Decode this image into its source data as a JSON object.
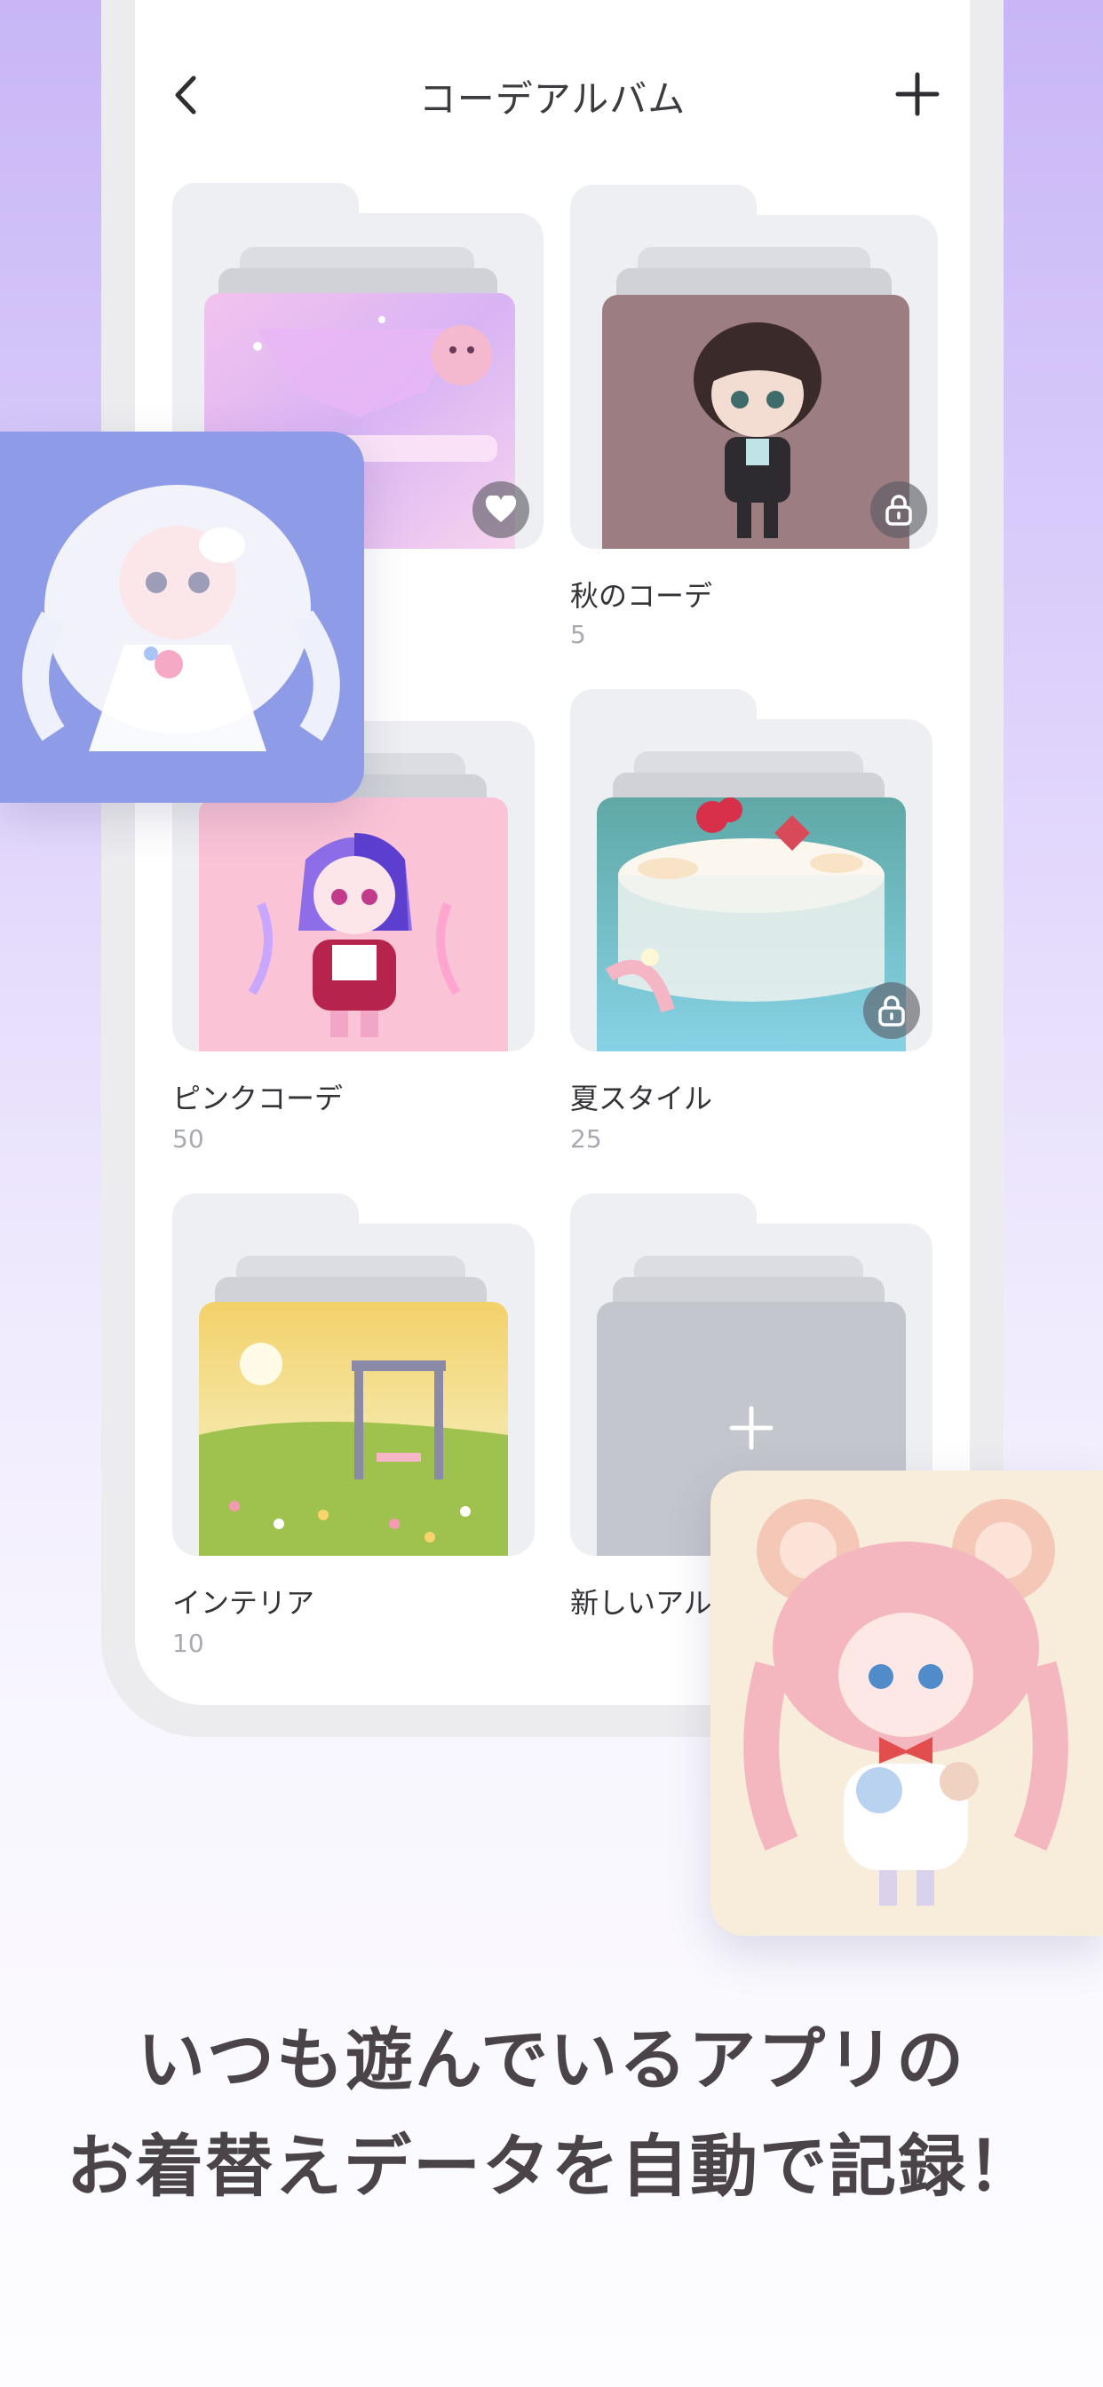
{
  "header": {
    "title": "コーデアルバム"
  },
  "albums": [
    {
      "name": "",
      "count": "",
      "badge": "heart-icon"
    },
    {
      "name": "秋のコーデ",
      "count": "5",
      "badge": "lock-icon"
    },
    {
      "name": "ピンクコーデ",
      "count": "50",
      "badge": ""
    },
    {
      "name": "夏スタイル",
      "count": "25",
      "badge": "lock-icon"
    },
    {
      "name": "インテリア",
      "count": "10",
      "badge": ""
    },
    {
      "name": "新しいアル",
      "count": "",
      "badge": "plus-icon"
    }
  ],
  "caption": {
    "line1": "いつも遊んでいるアプリの",
    "line2": "お着替えデータを自動で記録！"
  },
  "colors": {
    "bg_top": "#c8b6f6",
    "folder": "#eeeff2",
    "left_card": "#8e9be6",
    "right_card": "#f8eddb",
    "caption": "#4a4448"
  }
}
